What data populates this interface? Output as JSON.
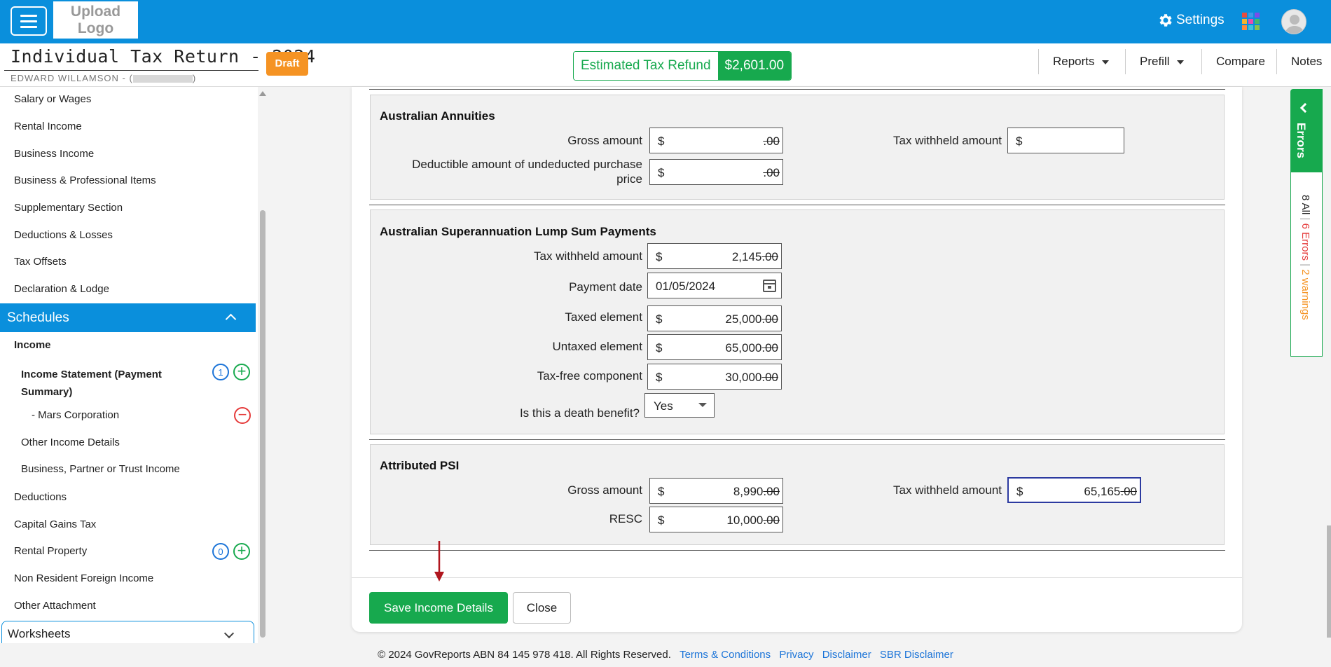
{
  "topbar": {
    "logo_line1": "Upload",
    "logo_line2": "Logo",
    "settings_label": "Settings",
    "apps_colors": [
      "#e84c3d",
      "#3d9be8",
      "#7c4ce8",
      "#f5b32e",
      "#e84cb0",
      "#45b86a",
      "#ff8a3d",
      "#3dc4d8",
      "#8bc34a"
    ]
  },
  "header": {
    "title": "Individual Tax Return - 2024",
    "client_name": "EDWARD WILLAMSON - (",
    "client_name_end": ")",
    "status_badge": "Draft",
    "refund_label": "Estimated Tax Refund",
    "refund_value": "$2,601.00",
    "nav": {
      "reports": "Reports",
      "prefill": "Prefill",
      "compare": "Compare",
      "notes": "Notes"
    }
  },
  "sidebar": {
    "items": [
      "Salary or Wages",
      "Rental Income",
      "Business Income",
      "Business & Professional Items",
      "Supplementary Section",
      "Deductions & Losses",
      "Tax Offsets",
      "Declaration & Lodge"
    ],
    "schedules_label": "Schedules",
    "income_label": "Income",
    "income_statement_line1": "Income Statement (Payment",
    "income_statement_line2": "Summary)",
    "income_statement_count": "1",
    "mars_corp": "-  Mars Corporation",
    "other_income": "Other Income Details",
    "business_partner": "Business, Partner or Trust Income",
    "deductions": "Deductions",
    "capital_gains": "Capital Gains Tax",
    "rental_property": "Rental Property",
    "rental_property_count": "0",
    "non_resident": "Non Resident Foreign Income",
    "other_attachment": "Other Attachment",
    "worksheets_label": "Worksheets"
  },
  "annuities": {
    "title": "Australian Annuities",
    "gross_label": "Gross amount",
    "gross_value": "",
    "gross_cents": ".00",
    "deductible_label_line1": "Deductible amount of undeducted purchase",
    "deductible_label_line2": "price",
    "deductible_value": "",
    "deductible_cents": ".00",
    "tax_withheld_label": "Tax withheld amount",
    "tax_withheld_value": ""
  },
  "super_lump_sum": {
    "title": "Australian Superannuation Lump Sum Payments",
    "tax_withheld_label": "Tax withheld amount",
    "tax_withheld_value": "2,145",
    "tax_withheld_cents": ".00",
    "payment_date_label": "Payment date",
    "payment_date_value": "01/05/2024",
    "taxed_label": "Taxed element",
    "taxed_value": "25,000",
    "taxed_cents": ".00",
    "untaxed_label": "Untaxed element",
    "untaxed_value": "65,000",
    "untaxed_cents": ".00",
    "taxfree_label": "Tax-free component",
    "taxfree_value": "30,000",
    "taxfree_cents": ".00",
    "death_benefit_label": "Is this a death benefit?",
    "death_benefit_value": "Yes"
  },
  "psi": {
    "title": "Attributed PSI",
    "gross_label": "Gross amount",
    "gross_value": "8,990",
    "gross_cents": ".00",
    "resc_label": "RESC",
    "resc_value": "10,000",
    "resc_cents": ".00",
    "tax_withheld_label": "Tax withheld amount",
    "tax_withheld_value": "65,165",
    "tax_withheld_cents": ".00"
  },
  "currency_symbol": "$",
  "actions": {
    "save_label": "Save Income Details",
    "close_label": "Close"
  },
  "errors_panel": {
    "tab_label": "Errors",
    "all_label": "8 All",
    "errors_label": "6 Errors",
    "warnings_label": "2 warnings",
    "separator": "|"
  },
  "footer": {
    "copyright": "© 2024 GovReports ABN 84 145 978 418. All Rights Reserved.",
    "links": [
      "Terms & Conditions",
      "Privacy",
      "Disclaimer",
      "SBR Disclaimer"
    ]
  }
}
